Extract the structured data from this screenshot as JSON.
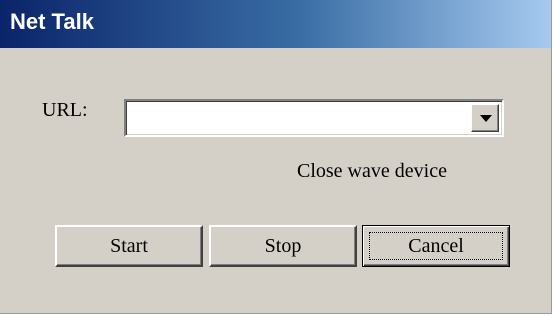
{
  "window": {
    "title": "Net Talk"
  },
  "form": {
    "url_label": "URL:",
    "url_value": "",
    "dropdown_icon": "chevron-down-icon"
  },
  "status": {
    "text": "Close wave device"
  },
  "buttons": {
    "start": "Start",
    "stop": "Stop",
    "cancel": "Cancel"
  },
  "colors": {
    "titlebar_start": "#0a246a",
    "titlebar_end": "#a6caf0",
    "dialog_background": "#d4d0c8"
  }
}
